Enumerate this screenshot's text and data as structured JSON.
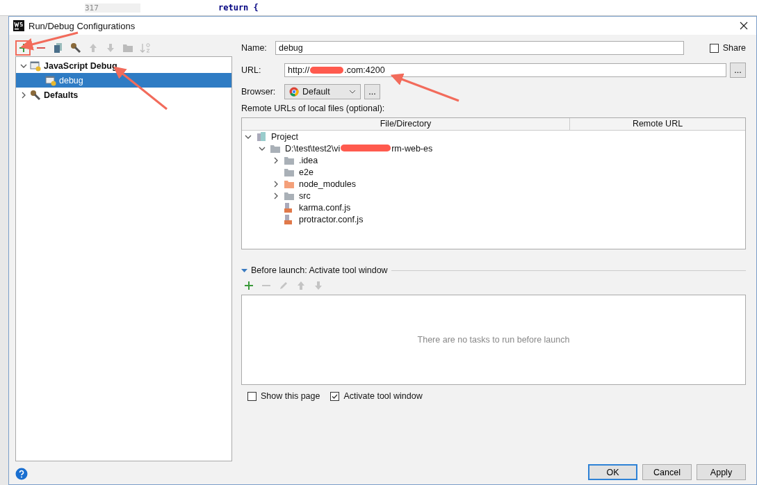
{
  "editor": {
    "line_number": "317",
    "code": "return {"
  },
  "window": {
    "title": "Run/Debug Configurations"
  },
  "toolbar": [
    {
      "kind": "add",
      "disabled": false
    },
    {
      "kind": "remove",
      "disabled": false
    },
    {
      "kind": "copy",
      "disabled": false
    },
    {
      "kind": "edit",
      "disabled": false
    },
    {
      "kind": "up",
      "disabled": true
    },
    {
      "kind": "down",
      "disabled": true
    },
    {
      "kind": "folder",
      "disabled": true
    },
    {
      "kind": "sort",
      "disabled": true
    }
  ],
  "config_tree": [
    {
      "label": "JavaScript Debug",
      "kind": "type",
      "expanded": true,
      "selected": false,
      "children": [
        {
          "label": "debug",
          "kind": "config",
          "selected": true
        }
      ]
    },
    {
      "label": "Defaults",
      "kind": "defaults",
      "expanded": false,
      "selected": false
    }
  ],
  "form": {
    "name_label": "Name:",
    "name": "debug",
    "share": {
      "label": "Share",
      "checked": false
    },
    "url_label": "URL:",
    "url_prefix": "http://",
    "url_suffix": ".com:4200",
    "url_button": "...",
    "browser_label": "Browser:",
    "browser": "Default",
    "browser_button": "...",
    "remote_label": "Remote URLs of local files (optional):",
    "columns": [
      "File/Directory",
      "Remote URL"
    ],
    "files": [
      {
        "label": "Project",
        "kind": "project",
        "expanded": true,
        "children": [
          {
            "label": "D:\\test\\test2\\vi",
            "label_end": "rm-web-es",
            "kind": "folder",
            "expanded": true,
            "children": [
              {
                "label": ".idea",
                "kind": "folder",
                "expanded": false
              },
              {
                "label": "e2e",
                "kind": "folder"
              },
              {
                "label": "node_modules",
                "kind": "excluded",
                "expanded": false
              },
              {
                "label": "src",
                "kind": "folder",
                "expanded": false
              },
              {
                "label": "karma.conf.js",
                "kind": "js"
              },
              {
                "label": "protractor.conf.js",
                "kind": "js"
              }
            ]
          }
        ]
      }
    ]
  },
  "before_launch": {
    "title": "Before launch: Activate tool window",
    "expanded": true,
    "toolbar": [
      {
        "kind": "add",
        "disabled": false
      },
      {
        "kind": "remove",
        "disabled": true
      },
      {
        "kind": "edit",
        "disabled": true
      },
      {
        "kind": "up",
        "disabled": true
      },
      {
        "kind": "down",
        "disabled": true
      }
    ],
    "empty_text": "There are no tasks to run before launch"
  },
  "options": [
    {
      "label": "Show this page",
      "checked": false
    },
    {
      "label": "Activate tool window",
      "checked": true
    }
  ],
  "buttons": [
    {
      "label": "OK",
      "kind": "default"
    },
    {
      "label": "Cancel",
      "kind": "normal"
    },
    {
      "label": "Apply",
      "kind": "normal"
    }
  ]
}
